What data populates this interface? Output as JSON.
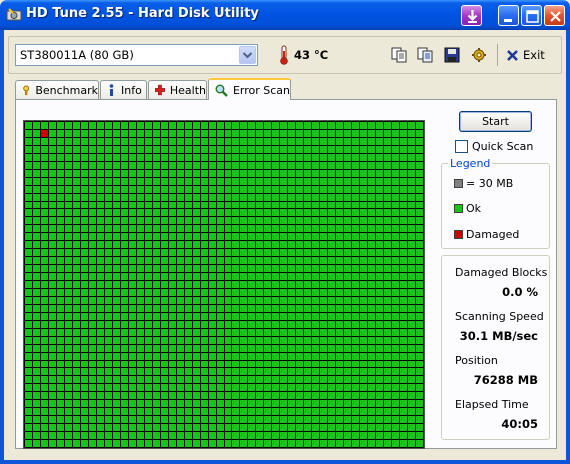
{
  "window": {
    "title": "HD Tune 2.55 - Hard Disk Utility",
    "controls": [
      "tray-icon",
      "minimize-icon",
      "maximize-icon",
      "close-icon"
    ]
  },
  "toolbar": {
    "drive": "ST380011A (80 GB)",
    "temperature": "43 °C",
    "icons": [
      "copy-icon",
      "copy-all-icon",
      "save-icon",
      "options-icon"
    ],
    "exit_label": "Exit"
  },
  "tabs": [
    {
      "label": "Benchmark",
      "icon": "benchmark-icon",
      "active": false
    },
    {
      "label": "Info",
      "icon": "info-icon",
      "active": false
    },
    {
      "label": "Health",
      "icon": "health-icon",
      "active": false
    },
    {
      "label": "Error Scan",
      "icon": "magnifier-icon",
      "active": true
    }
  ],
  "scan": {
    "start_label": "Start",
    "quick_scan_label": "Quick Scan",
    "quick_scan_checked": false,
    "columns": 50,
    "rows": 41,
    "damaged_cells": [
      {
        "row": 1,
        "col": 2
      }
    ]
  },
  "legend": {
    "title": "Legend",
    "items": [
      {
        "label": "= 30 MB",
        "color": "#808080"
      },
      {
        "label": "Ok",
        "color": "#18c418"
      },
      {
        "label": "Damaged",
        "color": "#d00000"
      }
    ]
  },
  "stats": {
    "damaged_blocks_label": "Damaged Blocks",
    "damaged_blocks_value": "0.0 %",
    "speed_label": "Scanning Speed",
    "speed_value": "30.1 MB/sec",
    "position_label": "Position",
    "position_value": "76288 MB",
    "elapsed_label": "Elapsed Time",
    "elapsed_value": "40:05"
  },
  "colors": {
    "titlebar": "#0054e3",
    "block_ok": "#18c418",
    "block_damaged": "#d00000",
    "legend_title": "#0046d5"
  }
}
